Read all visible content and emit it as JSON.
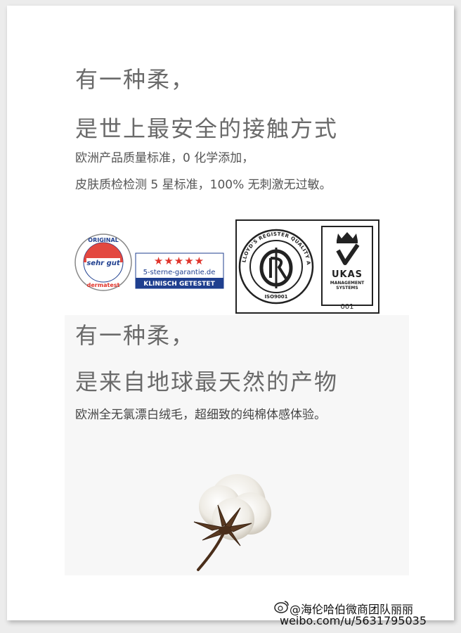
{
  "section1": {
    "heading1": "有一种柔，",
    "heading2": "是世上最安全的接触方式",
    "line1": "欧洲产品质量标准，0 化学添加，",
    "line2": "皮肤质检检测 5 星标准，100% 无刺激无过敏。"
  },
  "dermatest_badge": {
    "ring_top": "ORIGINAL",
    "center": "sehr gut",
    "ring_bottom": "dermatest",
    "stars": "★★★★★",
    "site": "5-sterne-garantie.de",
    "tagline": "KLINISCH GETESTET"
  },
  "lloyds_badge": {
    "ring_text": "LLOYD'S REGISTER QUALITY ASSURANCE",
    "iso": "ISO9001",
    "center_letters": "LRQ"
  },
  "ukas_badge": {
    "name": "UKAS",
    "subtitle1": "MANAGEMENT",
    "subtitle2": "SYSTEMS",
    "number": "001"
  },
  "section2": {
    "heading1": "有一种柔，",
    "heading2": "是来自地球最天然的产物",
    "line1": "欧洲全无氯漂白绒毛，超细致的纯棉体感体验。"
  },
  "watermark": {
    "handle": "@海伦哈伯微商团队丽丽",
    "url": "weibo.com/u/5631795035"
  },
  "colors": {
    "star_red": "#e0342b",
    "badge_blue": "#1f3f8f",
    "text_gray": "#5d5d5d"
  }
}
